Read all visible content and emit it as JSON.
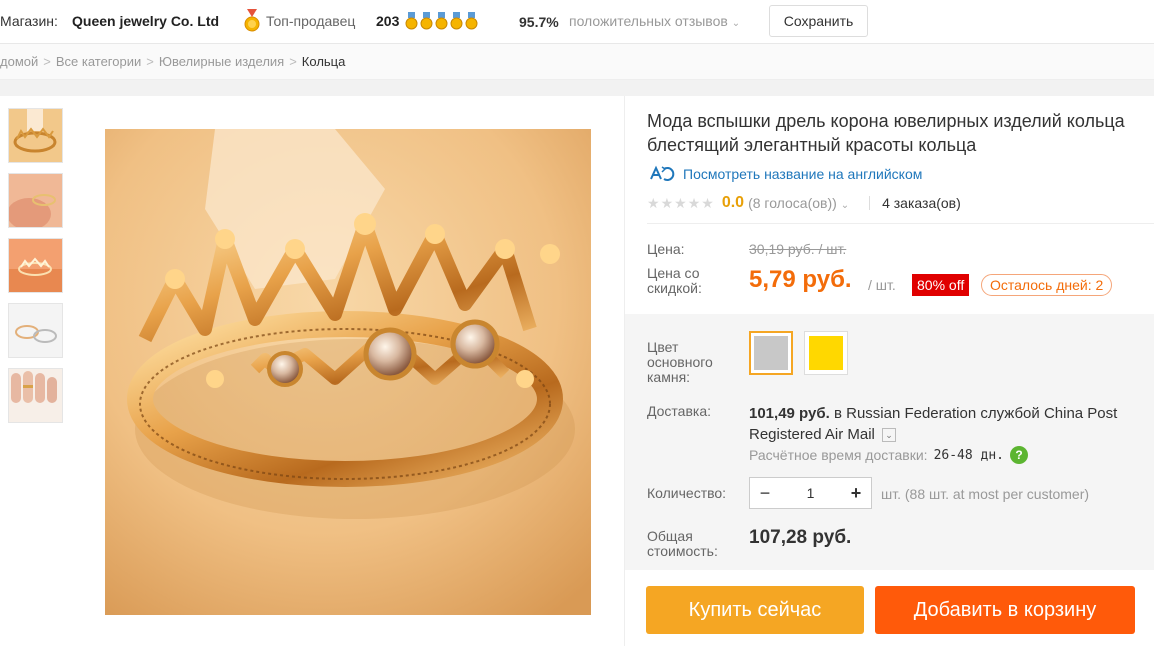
{
  "store": {
    "label": "Магазин:",
    "name": "Queen jewelry Co. Ltd",
    "badge_icon": "medal-icon",
    "top_seller": "Топ-продавец",
    "score": "203",
    "feedback_percent": "95.7%",
    "feedback_label": "положительных отзывов",
    "save_label": "Сохранить"
  },
  "breadcrumb": [
    "домой",
    "Все категории",
    "Ювелирные изделия",
    "Кольца"
  ],
  "product": {
    "title": "Мода вспышки дрель корона ювелирных изделий кольца блестящий элегантный красоты кольца",
    "translate_link": "Посмотреть название на английском",
    "rating": "0.0",
    "votes": "(8 голоса(ов))",
    "orders": "4 заказа(ов)"
  },
  "pricing": {
    "price_label": "Цена:",
    "old_price": "30,19 руб. / шт.",
    "discount_label": "Цена со скидкой:",
    "new_price": "5,79 руб.",
    "per_unit": "/ шт.",
    "off_badge": "80% off",
    "days_left": "Осталось дней: 2"
  },
  "options": {
    "color_label": "Цвет основного камня:",
    "swatches": [
      {
        "color": "#c8c8c8",
        "selected": true
      },
      {
        "color": "#ffd800",
        "selected": false
      }
    ]
  },
  "shipping": {
    "label": "Доставка:",
    "price": "101,49 руб.",
    "text": "в Russian Federation службой China Post Registered Air Mail",
    "eta_label": "Расчётное время доставки:",
    "eta_days": "26-48 дн."
  },
  "quantity": {
    "label": "Количество:",
    "value": "1",
    "note": "шт. (88 шт. at most per customer)"
  },
  "total": {
    "label": "Общая стоимость:",
    "value": "107,28 руб."
  },
  "actions": {
    "buy_now": "Купить сейчас",
    "add_to_cart": "Добавить в корзину"
  },
  "colors": {
    "accent_orange": "#f36c0a",
    "buy_button": "#f5a623",
    "cart_button": "#ff5a0a",
    "off_badge": "#e00000",
    "link_blue": "#1f77bb"
  }
}
